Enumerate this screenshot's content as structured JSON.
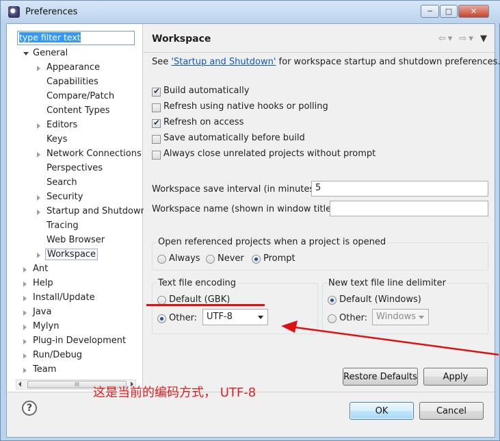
{
  "window": {
    "title": "Preferences"
  },
  "filter": {
    "placeholder": "type filter text"
  },
  "tree": {
    "general": "General",
    "children": [
      "Appearance",
      "Capabilities",
      "Compare/Patch",
      "Content Types",
      "Editors",
      "Keys",
      "Network Connections",
      "Perspectives",
      "Search",
      "Security",
      "Startup and Shutdown",
      "Tracing",
      "Web Browser",
      "Workspace"
    ],
    "top": [
      "Ant",
      "Help",
      "Install/Update",
      "Java",
      "Mylyn",
      "Plug-in Development",
      "Run/Debug",
      "Team"
    ],
    "scroll_grip": "III"
  },
  "page": {
    "title": "Workspace",
    "desc_prefix": "See ",
    "desc_link": "'Startup and Shutdown'",
    "desc_suffix": " for workspace startup and shutdown preferences.",
    "checkboxes": [
      {
        "label": "Build automatically",
        "checked": true
      },
      {
        "label": "Refresh using native hooks or polling",
        "checked": false
      },
      {
        "label": "Refresh on access",
        "checked": true
      },
      {
        "label": "Save automatically before build",
        "checked": false
      },
      {
        "label": "Always close unrelated projects without prompt",
        "checked": false
      }
    ],
    "save_interval_label": "Workspace save interval (in minutes):",
    "save_interval_value": "5",
    "ws_name_label": "Workspace name (shown in window title):",
    "ws_name_value": "",
    "open_ref": {
      "label": "Open referenced projects when a project is opened",
      "options": [
        "Always",
        "Never",
        "Prompt"
      ],
      "selected": "Prompt"
    },
    "encoding": {
      "label": "Text file encoding",
      "default": "Default (GBK)",
      "other": "Other:",
      "value": "UTF-8",
      "selected": "Other"
    },
    "delimiter": {
      "label": "New text file line delimiter",
      "default": "Default (Windows)",
      "other": "Other:",
      "value": "Windows",
      "selected": "Default"
    },
    "restore_defaults": "Restore Defaults",
    "apply": "Apply"
  },
  "footer": {
    "ok": "OK",
    "cancel": "Cancel",
    "help_icon": "?"
  },
  "annotation": {
    "text": "这是当前的编码方式， UTF-8",
    "color": "#e02020"
  }
}
